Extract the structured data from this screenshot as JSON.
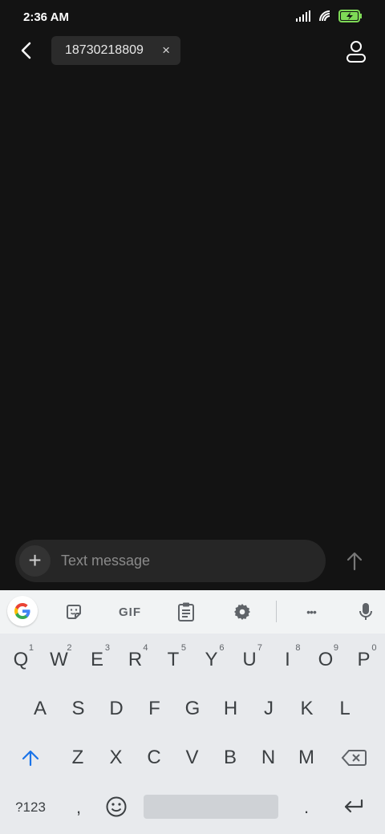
{
  "status": {
    "time": "2:36 AM",
    "battery_color": "#7ed957"
  },
  "header": {
    "recipient": "18730218809",
    "remove_glyph": "×"
  },
  "composer": {
    "placeholder": "Text message",
    "plus_glyph": "+"
  },
  "keyboard": {
    "toolbar": {
      "gif_label": "GIF",
      "more_glyph": "•••"
    },
    "row1": [
      {
        "k": "Q",
        "h": "1"
      },
      {
        "k": "W",
        "h": "2"
      },
      {
        "k": "E",
        "h": "3"
      },
      {
        "k": "R",
        "h": "4"
      },
      {
        "k": "T",
        "h": "5"
      },
      {
        "k": "Y",
        "h": "6"
      },
      {
        "k": "U",
        "h": "7"
      },
      {
        "k": "I",
        "h": "8"
      },
      {
        "k": "O",
        "h": "9"
      },
      {
        "k": "P",
        "h": "0"
      }
    ],
    "row2": [
      "A",
      "S",
      "D",
      "F",
      "G",
      "H",
      "J",
      "K",
      "L"
    ],
    "row3": [
      "Z",
      "X",
      "C",
      "V",
      "B",
      "N",
      "M"
    ],
    "sym_label": "?123",
    "comma": ",",
    "period": ".",
    "accent": "#1a73e8"
  }
}
